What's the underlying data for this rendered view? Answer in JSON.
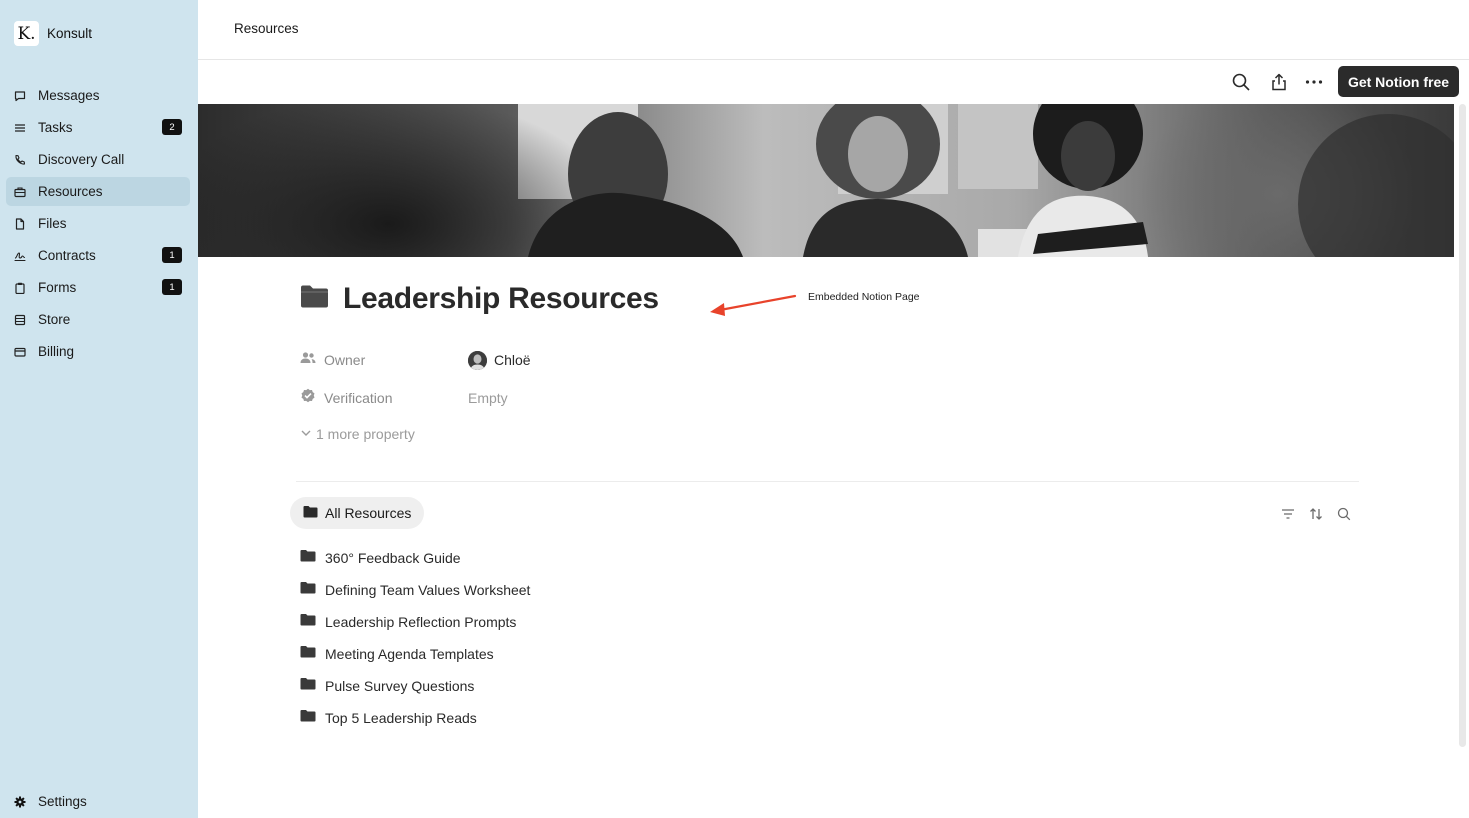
{
  "app": {
    "logo_letter": "K.",
    "name": "Konsult"
  },
  "sidebar": {
    "items": [
      {
        "label": "Messages",
        "icon": "message-icon",
        "badge": ""
      },
      {
        "label": "Tasks",
        "icon": "list-icon",
        "badge": "2"
      },
      {
        "label": "Discovery Call",
        "icon": "phone-icon",
        "badge": ""
      },
      {
        "label": "Resources",
        "icon": "briefcase-icon",
        "badge": "",
        "active": true
      },
      {
        "label": "Files",
        "icon": "file-icon",
        "badge": ""
      },
      {
        "label": "Contracts",
        "icon": "signature-icon",
        "badge": "1"
      },
      {
        "label": "Forms",
        "icon": "clipboard-icon",
        "badge": "1"
      },
      {
        "label": "Store",
        "icon": "store-icon",
        "badge": ""
      },
      {
        "label": "Billing",
        "icon": "credit-card-icon",
        "badge": ""
      }
    ],
    "settings_label": "Settings"
  },
  "header": {
    "title": "Resources"
  },
  "notion": {
    "cta_label": "Get Notion free",
    "page_title": "Leadership Resources",
    "annotation": "Embedded Notion Page",
    "properties": [
      {
        "label": "Owner",
        "value": "Chloë",
        "icon": "people-icon"
      },
      {
        "label": "Verification",
        "value": "Empty",
        "icon": "verified-icon"
      }
    ],
    "more_property": "1 more property",
    "view_tab": "All Resources",
    "resources": [
      "360° Feedback Guide",
      "Defining Team Values Worksheet",
      "Leadership Reflection Prompts",
      "Meeting Agenda Templates",
      "Pulse Survey Questions",
      "Top 5 Leadership Reads"
    ]
  },
  "colors": {
    "sidebar_bg": "#cfe4ee",
    "sidebar_active": "#bcd6e2",
    "annotation_arrow": "#e8432b",
    "badge_bg": "#111111"
  }
}
